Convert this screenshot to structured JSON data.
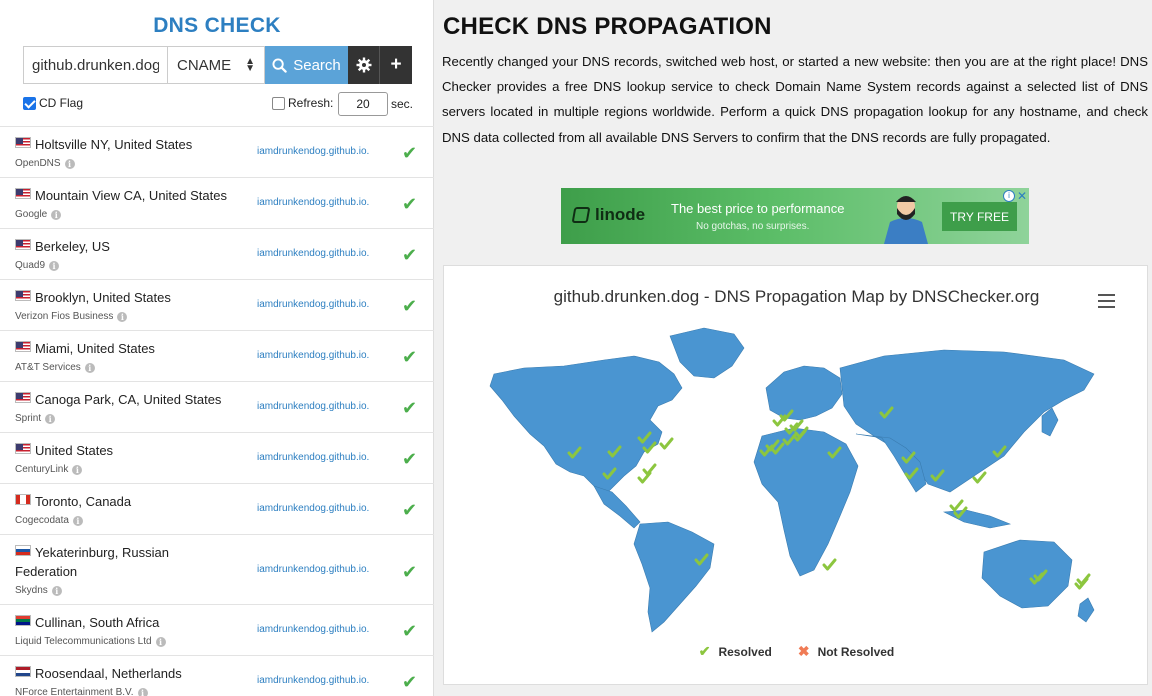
{
  "brand": "DNS CHECK",
  "search": {
    "domain": "github.drunken.dog",
    "record_type": "CNAME",
    "search_label": "Search",
    "cd_flag_label": "CD Flag",
    "cd_flag_checked": true,
    "refresh_label": "Refresh:",
    "refresh_checked": false,
    "refresh_value": "20",
    "sec_label": "sec."
  },
  "results": [
    {
      "location": "Holtsville NY, United States",
      "provider": "OpenDNS",
      "result": "iamdrunkendog.github.io.",
      "flag": "us"
    },
    {
      "location": "Mountain View CA, United States",
      "provider": "Google",
      "result": "iamdrunkendog.github.io.",
      "flag": "us"
    },
    {
      "location": "Berkeley, US",
      "provider": "Quad9",
      "result": "iamdrunkendog.github.io.",
      "flag": "us"
    },
    {
      "location": "Brooklyn, United States",
      "provider": "Verizon Fios Business",
      "result": "iamdrunkendog.github.io.",
      "flag": "us"
    },
    {
      "location": "Miami, United States",
      "provider": "AT&T Services",
      "result": "iamdrunkendog.github.io.",
      "flag": "us"
    },
    {
      "location": "Canoga Park, CA, United States",
      "provider": "Sprint",
      "result": "iamdrunkendog.github.io.",
      "flag": "us"
    },
    {
      "location": "United States",
      "provider": "CenturyLink",
      "result": "iamdrunkendog.github.io.",
      "flag": "us"
    },
    {
      "location": "Toronto, Canada",
      "provider": "Cogecodata",
      "result": "iamdrunkendog.github.io.",
      "flag": "ca"
    },
    {
      "location": "Yekaterinburg, Russian Federation",
      "provider": "Skydns",
      "result": "iamdrunkendog.github.io.",
      "flag": "ru"
    },
    {
      "location": "Cullinan, South Africa",
      "provider": "Liquid Telecommunications Ltd",
      "result": "iamdrunkendog.github.io.",
      "flag": "za"
    },
    {
      "location": "Roosendaal, Netherlands",
      "provider": "NForce Entertainment B.V.",
      "result": "iamdrunkendog.github.io.",
      "flag": "nl"
    }
  ],
  "main": {
    "heading": "CHECK DNS PROPAGATION",
    "description": "Recently changed your DNS records, switched web host, or started a new website: then you are at the right place! DNS Checker provides a free DNS lookup service to check Domain Name System records against a selected list of DNS servers located in multiple regions worldwide. Perform a quick DNS propagation lookup for any hostname, and check DNS data collected from all available DNS Servers to confirm that the DNS records are fully propagated."
  },
  "ad": {
    "brand": "linode",
    "headline": "The best price to performance",
    "subline": "No gotchas, no surprises.",
    "cta": "TRY FREE",
    "accent": "#3e9e4a"
  },
  "map": {
    "title": "github.drunken.dog - DNS Propagation Map by DNSChecker.org",
    "legend_resolved": "Resolved",
    "legend_not_resolved": "Not Resolved",
    "land_color": "#4a95d1",
    "ocean_color": "#ffffff",
    "resolved_color": "#8cc63f",
    "not_resolved_color": "#f07b55"
  }
}
